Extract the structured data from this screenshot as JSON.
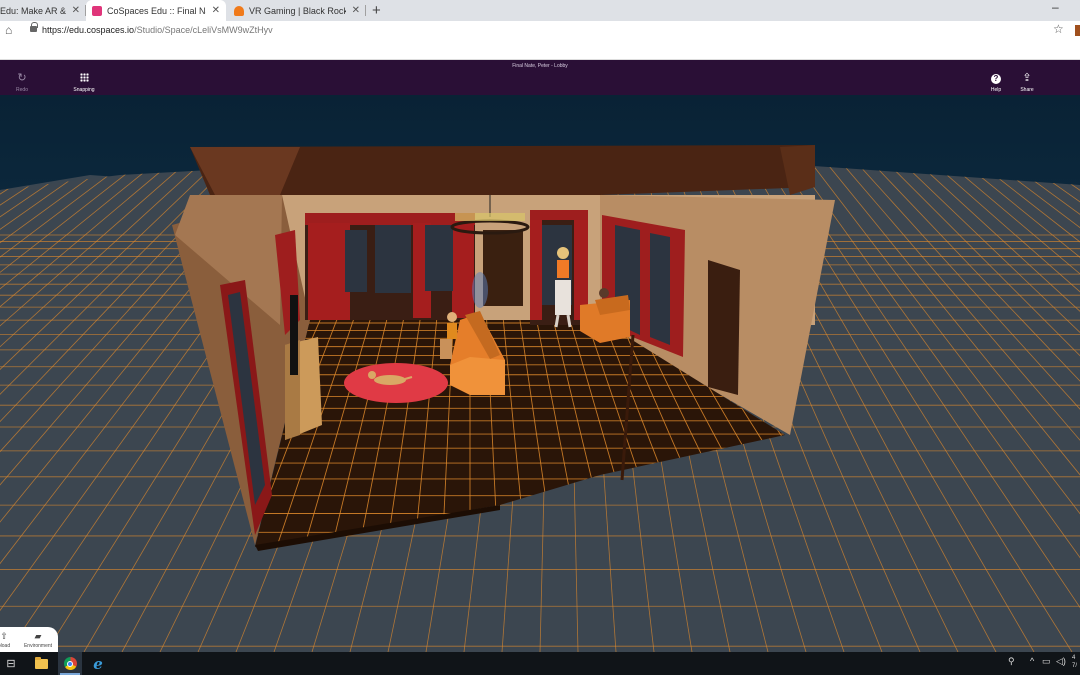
{
  "browser": {
    "tabs": [
      {
        "title": "Edu: Make AR & VR in",
        "favicon_color": "#9a9a9a",
        "active": false
      },
      {
        "title": "CoSpaces Edu :: Final Nate, Peter",
        "favicon_color": "#e0357a",
        "active": true
      },
      {
        "title": "VR Gaming | Black Rocket",
        "favicon_color": "#f07a1a",
        "active": false
      }
    ],
    "new_tab_icon": "plus-icon",
    "minimize_glyph": "–",
    "url_host": "https://edu.cospaces.io",
    "url_path": "/Studio/Space/cLeliVsMW9wZtHyv"
  },
  "app": {
    "space_title": "Final Nate, Peter - Lobby",
    "tools_left": [
      {
        "label": "Redo",
        "icon": "redo-icon"
      },
      {
        "label": "Snapping",
        "icon": "grid-icon"
      }
    ],
    "tools_right": [
      {
        "label": "Help",
        "icon": "help-icon"
      },
      {
        "label": "Share",
        "icon": "share-icon"
      }
    ],
    "bottom_panel": [
      {
        "label": "pload",
        "icon": "upload-icon"
      },
      {
        "label": "Environment",
        "icon": "environment-icon"
      }
    ],
    "header_color": "#2a0f36",
    "grid_line_color": "#e08a2c"
  },
  "taskbar": {
    "clock_line1": "4",
    "clock_line2": "7/"
  }
}
